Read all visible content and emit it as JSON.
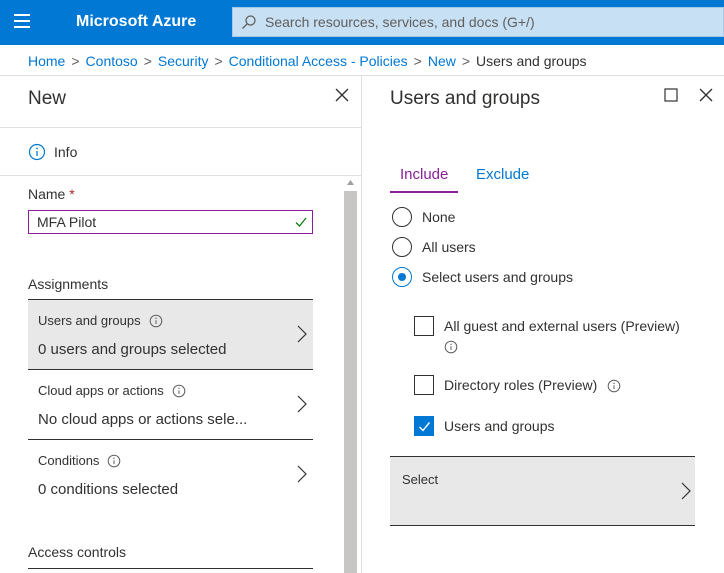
{
  "app": {
    "brand": "Microsoft Azure"
  },
  "search": {
    "placeholder": "Search resources, services, and docs (G+/)"
  },
  "breadcrumb": {
    "items": [
      "Home",
      "Contoso",
      "Security",
      "Conditional Access - Policies",
      "New"
    ],
    "current": "Users and groups",
    "separator": ">"
  },
  "left_pane": {
    "title": "New",
    "info_label": "Info",
    "name_label": "Name",
    "required_marker": "*",
    "name_value": "MFA Pilot",
    "assignments_label": "Assignments",
    "items": [
      {
        "title": "Users and groups",
        "subtitle": "0 users and groups selected",
        "selected": true
      },
      {
        "title": "Cloud apps or actions",
        "subtitle": "No cloud apps or actions sele...",
        "selected": false
      },
      {
        "title": "Conditions",
        "subtitle": "0 conditions selected",
        "selected": false
      }
    ],
    "access_controls_label": "Access controls"
  },
  "right_pane": {
    "title": "Users and groups",
    "tabs": [
      {
        "label": "Include",
        "active": true
      },
      {
        "label": "Exclude",
        "active": false
      }
    ],
    "radios": [
      {
        "label": "None",
        "checked": false
      },
      {
        "label": "All users",
        "checked": false
      },
      {
        "label": "Select users and groups",
        "checked": true
      }
    ],
    "checkboxes": [
      {
        "label": "All guest and external users (Preview)",
        "checked": false
      },
      {
        "label": "Directory roles (Preview)",
        "checked": false
      },
      {
        "label": "Users and groups",
        "checked": true
      }
    ],
    "select_label": "Select"
  },
  "colors": {
    "azure_blue": "#0078d4",
    "accent_purple": "#8a1f99",
    "success_green": "#107c10",
    "selected_bg": "#e8e8e8"
  }
}
